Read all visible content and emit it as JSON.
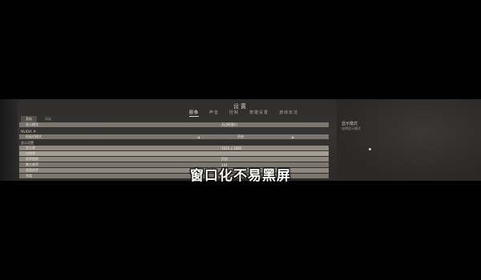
{
  "settings": {
    "title": "设置",
    "tabs": [
      "图像",
      "声音",
      "控制",
      "按键设置",
      "游戏玩法"
    ],
    "active_tab_index": 0,
    "subtabs": [
      "基础",
      "高级"
    ],
    "rows": [
      {
        "label": "显示模式",
        "value": "无边框窗口"
      },
      {
        "label": "NVIDIA ®",
        "value": ""
      },
      {
        "label": "低延迟模式",
        "value": "开启"
      },
      {
        "label": "显示设置",
        "value": ""
      },
      {
        "label": "显示器",
        "value": "1920 x 1080"
      },
      {
        "label": "分辨率",
        "value": ""
      },
      {
        "label": "帧率限制",
        "value": "开启"
      },
      {
        "label": "最大帧率",
        "value": "144"
      },
      {
        "label": "垂直同步",
        "value": "关闭"
      },
      {
        "label": "亮度",
        "value": "50"
      }
    ],
    "side_panel": {
      "title": "显示模式",
      "description": "选择显示模式"
    }
  },
  "caption": "窗口化不易黑屏",
  "colors": {
    "background": "#000000",
    "screen": "#333130",
    "row_highlight": "#a59d92",
    "subtitle": "#ffffff"
  }
}
